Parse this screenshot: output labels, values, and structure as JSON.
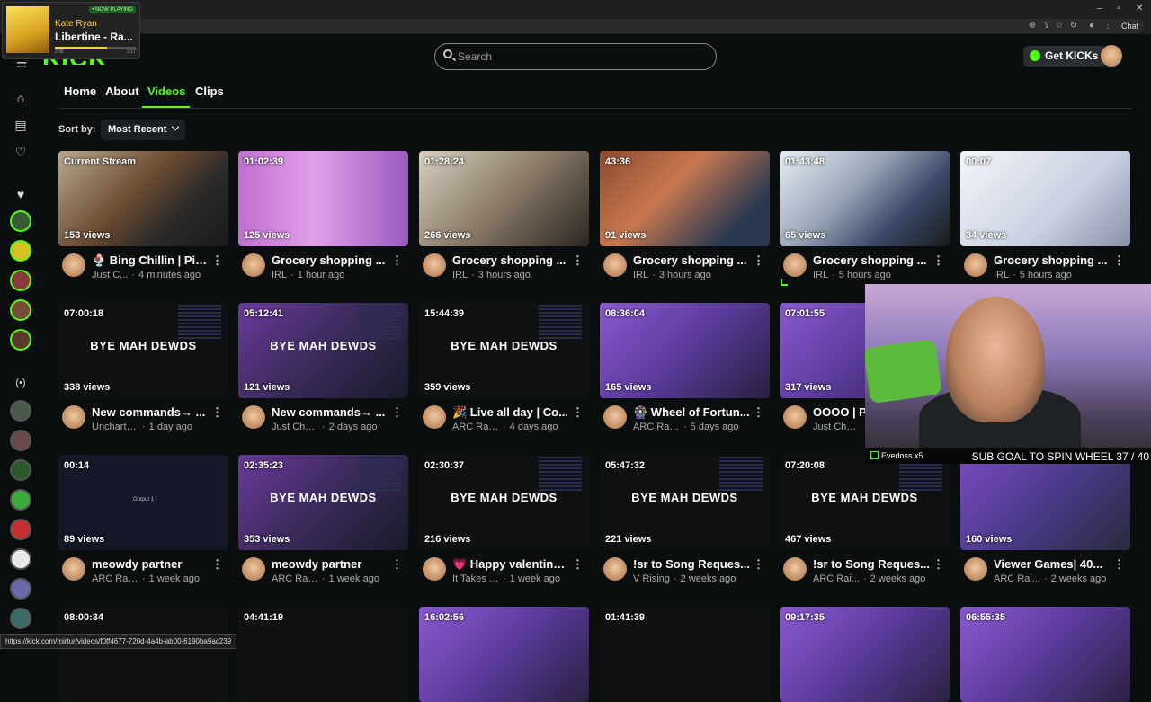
{
  "browser": {
    "chat_label": "Chat",
    "status_url": "https://kick.com/mirtur/videos/f0ff4677-720d-4a4b-ab00-6190ba9ac239"
  },
  "now_playing": {
    "badge": "• NOW PLAYING",
    "artist": "Kate Ryan",
    "title": "Libertine - Ra...",
    "elapsed": "2:35",
    "total": "3:17",
    "progress": 0.64
  },
  "header": {
    "logo": "KICK",
    "search_placeholder": "Search",
    "get_kicks": "Get KICKs"
  },
  "tabs": [
    "Home",
    "About",
    "Videos",
    "Clips"
  ],
  "active_tab": "Videos",
  "sort": {
    "label": "Sort by:",
    "value": "Most Recent"
  },
  "colors": {
    "accent": "#53fc18",
    "bg": "#0b0e0f"
  },
  "videos": [
    {
      "duration": "Current Stream",
      "views": "153 views",
      "title": "🍨 Bing Chillin | Pic...",
      "category": "Just C...",
      "age": "4 minutes ago",
      "overlay": "",
      "bg": "linear-gradient(135deg,#b8a890,#6a4a30 45%,#2a2a2a 70%,#1a1a1a)"
    },
    {
      "duration": "01:02:39",
      "views": "125 views",
      "title": "Grocery shopping ...",
      "category": "IRL",
      "age": "1 hour ago",
      "overlay": "",
      "bg": "linear-gradient(90deg,#c070d0,#e0a0e8 45%,#9a5ac0)"
    },
    {
      "duration": "01:28:24",
      "views": "266 views",
      "title": "Grocery shopping ...",
      "category": "IRL",
      "age": "3 hours ago",
      "overlay": "",
      "bg": "linear-gradient(135deg,#d8d0c0,#8a7a68 50%,#2a2620)"
    },
    {
      "duration": "43:36",
      "views": "91 views",
      "title": "Grocery shopping ...",
      "category": "IRL",
      "age": "3 hours ago",
      "overlay": "",
      "bg": "linear-gradient(135deg,#8a4a30,#c87850 40%,#2a3850 80%)"
    },
    {
      "duration": "01:43:48",
      "views": "65 views",
      "title": "Grocery shopping ...",
      "category": "IRL",
      "age": "5 hours ago",
      "overlay": "",
      "bg": "linear-gradient(135deg,#e8eef4,#9aa8b8 40%,#3a4a6a 70%,#1a1a1a)"
    },
    {
      "duration": "00:07",
      "views": "34 views",
      "title": "Grocery shopping ...",
      "category": "IRL",
      "age": "5 hours ago",
      "overlay": "",
      "bg": "linear-gradient(135deg,#f4f6fa,#c8d0e0 60%,#8a90a8)"
    },
    {
      "duration": "07:00:18",
      "views": "338 views",
      "title": "New commands→ ...",
      "category": "Uncharted ...",
      "age": "1 day ago",
      "overlay": "BYE MAH DEWDS",
      "bg": "#0f1012"
    },
    {
      "duration": "05:12:41",
      "views": "121 views",
      "title": "New commands→ ...",
      "category": "Just Chat...",
      "age": "2 days ago",
      "overlay": "BYE MAH DEWDS",
      "bg": "linear-gradient(135deg,#6a3a9a,#3a2a5a 50%,#1a1a2a)"
    },
    {
      "duration": "15:44:39",
      "views": "359 views",
      "title": "🎉 Live all day | Co...",
      "category": "ARC Raid...",
      "age": "4 days ago",
      "overlay": "BYE MAH DEWDS",
      "bg": "#0f1012"
    },
    {
      "duration": "08:36:04",
      "views": "165 views",
      "title": "🎡 Wheel of Fortun...",
      "category": "ARC Raid...",
      "age": "5 days ago",
      "overlay": "",
      "bg": "linear-gradient(135deg,#8a5ad0,#5a3a9a 50%,#2a2040)"
    },
    {
      "duration": "07:01:55",
      "views": "317 views",
      "title": "OOOO | PEAK",
      "category": "Just Chat...",
      "age": "",
      "overlay": "",
      "bg": "linear-gradient(135deg,#8a5ad0,#5a3a9a 50%,#2a2040)"
    },
    {
      "duration": "",
      "views": "",
      "title": "",
      "category": "",
      "age": "",
      "overlay": "",
      "bg": "#111"
    },
    {
      "duration": "00:14",
      "views": "89 views",
      "title": "meowdy partner",
      "category": "ARC Raid...",
      "age": "1 week ago",
      "overlay": "",
      "small": "Output 1",
      "bg": "#141828"
    },
    {
      "duration": "02:35:23",
      "views": "353 views",
      "title": "meowdy partner",
      "category": "ARC Raid...",
      "age": "1 week ago",
      "overlay": "BYE MAH DEWDS",
      "bg": "linear-gradient(135deg,#6a3a9a,#3a2a5a 50%,#1a1a2a)"
    },
    {
      "duration": "02:30:37",
      "views": "216 views",
      "title": "💗 Happy valentine...",
      "category": "It Takes T...",
      "age": "1 week ago",
      "overlay": "BYE MAH DEWDS",
      "bg": "#0f1012"
    },
    {
      "duration": "05:47:32",
      "views": "221 views",
      "title": "!sr to Song Reques...",
      "category": "V Rising",
      "age": "2 weeks ago",
      "overlay": "BYE MAH DEWDS",
      "bg": "#0f1012"
    },
    {
      "duration": "07:20:08",
      "views": "467 views",
      "title": "!sr to Song Reques...",
      "category": "ARC Rai...",
      "age": "2 weeks ago",
      "overlay": "BYE MAH DEWDS",
      "bg": "#0f1012"
    },
    {
      "duration": "",
      "views": "160 views",
      "title": "Viewer Games| 40...",
      "category": "ARC Rai...",
      "age": "2 weeks ago",
      "overlay": "",
      "bg": "linear-gradient(135deg,#7a4ac0,#4a3a8a 50%,#2a2a3a)"
    },
    {
      "duration": "08:00:34",
      "views": "",
      "title": "",
      "category": "",
      "age": "",
      "overlay": "",
      "bg": "#0f1012"
    },
    {
      "duration": "04:41:19",
      "views": "",
      "title": "",
      "category": "",
      "age": "",
      "overlay": "",
      "bg": "#0f1012"
    },
    {
      "duration": "16:02:56",
      "views": "",
      "title": "",
      "category": "",
      "age": "",
      "overlay": "",
      "bg": "linear-gradient(135deg,#8a5ad0,#5a3a9a 50%,#2a2040)"
    },
    {
      "duration": "01:41:39",
      "views": "",
      "title": "",
      "category": "",
      "age": "",
      "overlay": "",
      "bg": "#0f1012"
    },
    {
      "duration": "09:17:35",
      "views": "",
      "title": "",
      "category": "",
      "age": "",
      "overlay": "",
      "bg": "linear-gradient(135deg,#8a5ad0,#5a3a9a 50%,#2a2040)"
    },
    {
      "duration": "06:55:35",
      "views": "",
      "title": "",
      "category": "",
      "age": "",
      "overlay": "",
      "bg": "linear-gradient(135deg,#8a5ad0,#5a3a9a 50%,#2a2040)"
    }
  ],
  "webcam": {
    "gifter": "Evedoss x5",
    "goal": "SUB GOAL TO SPIN WHEEL 37 / 40"
  }
}
